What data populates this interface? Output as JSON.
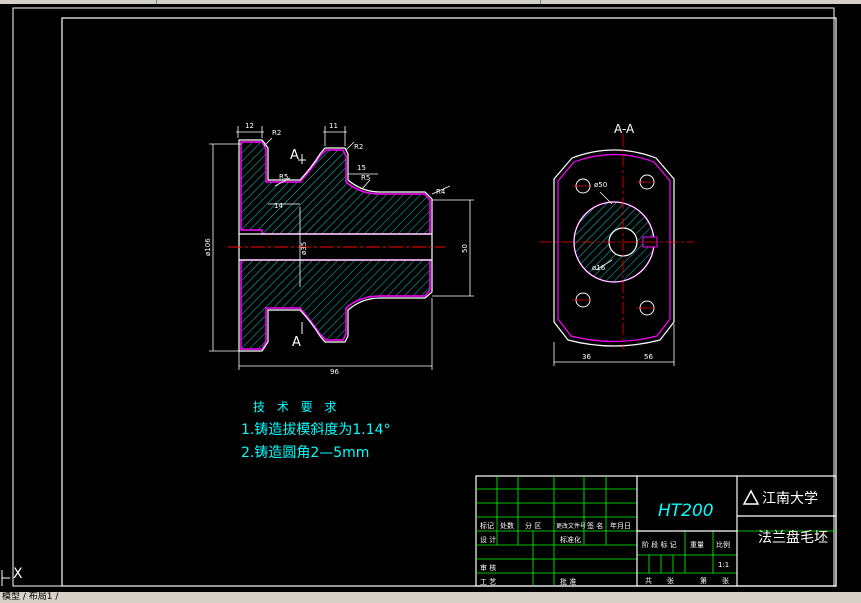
{
  "app": {
    "tabs_text": "模型 / 布局1 /",
    "ucs_x": "X"
  },
  "colors": {
    "background": "#000000",
    "outline": "#ffffff",
    "section": "#ff00ff",
    "centerline": "#ff0000",
    "hatch": "#00ffff",
    "dimension": "#ffffff",
    "text_cyan": "#00ffff",
    "titleblock": "#00ff00"
  },
  "drawing": {
    "section_label": "A-A",
    "cut_marks": [
      "A",
      "A"
    ],
    "dims_front": {
      "width_top_left": "12",
      "radius_top_left": "R2",
      "width_top_mid": "11",
      "radius_top_mid": "R2",
      "len_15": "15",
      "radius_r5": "R5",
      "radius_r5b": "R5",
      "len_14": "14",
      "radius_r4": "R4",
      "dia_large": "ø106",
      "dia_bore": "ø35",
      "dia_right": "50",
      "total_length": "96"
    },
    "dims_side": {
      "dia_50": "ø50",
      "dia_16": "ø16",
      "width_left": "36",
      "width_right": "56"
    }
  },
  "tech_req": {
    "title": "技 术 要 求",
    "items": [
      "1.铸造拔模斜度为1.14°",
      "2.铸造圆角2—5mm"
    ]
  },
  "titleblock": {
    "material": "HT200",
    "school": "江南大学",
    "part_name": "法兰盘毛坯",
    "row_headers": [
      "标记",
      "处数",
      "分 区",
      "更改文件号",
      "签 名",
      "年月日"
    ],
    "left_labels": [
      "设 计",
      "审 核",
      "工 艺"
    ],
    "std_label": "标准化",
    "approve_label": "批 准",
    "stage_label": "阶 段 标 记",
    "weight_label": "重量",
    "scale_label": "比例",
    "scale_value": "1:1",
    "sheet_text": [
      "共",
      "张",
      "第",
      "张"
    ]
  }
}
